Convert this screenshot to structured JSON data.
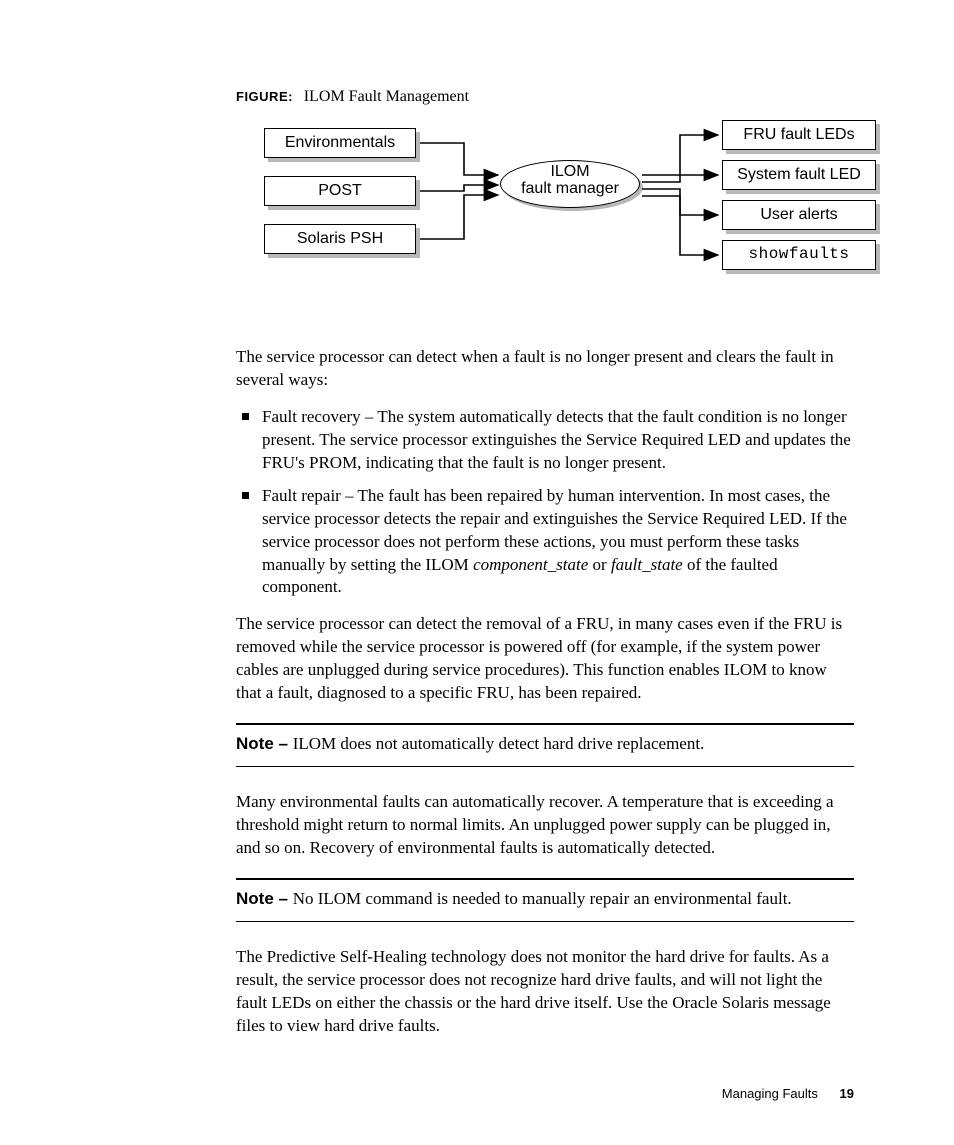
{
  "figure": {
    "label": "FIGURE:",
    "title": "ILOM Fault Management",
    "left_boxes": [
      "Environmentals",
      "POST",
      "Solaris PSH"
    ],
    "center_line1": "ILOM",
    "center_line2": "fault manager",
    "right_boxes": [
      "FRU fault LEDs",
      "System fault LED",
      "User alerts",
      "showfaults"
    ]
  },
  "para1": "The service processor can detect when a fault is no longer present and clears the fault in several ways:",
  "bullets": [
    {
      "lead": "Fault recovery – ",
      "rest": "The system automatically detects that the fault condition is no longer present. The service processor extinguishes the Service Required LED and updates the FRU's PROM, indicating that the fault is no longer present."
    },
    {
      "lead": "Fault repair – ",
      "rest_before": "The fault has been repaired by human intervention. In most cases, the service processor detects the repair and extinguishes the Service Required LED. If the service processor does not perform these actions, you must perform these tasks manually by setting the ILOM ",
      "ital1": "component_state",
      "mid": " or ",
      "ital2": "fault_state",
      "rest_after": " of the faulted component."
    }
  ],
  "para2": "The service processor can detect the removal of a FRU, in many cases even if the FRU is removed while the service processor is powered off (for example, if the system power cables are unplugged during service procedures). This function enables ILOM to know that a fault, diagnosed to a specific FRU, has been repaired.",
  "note1": {
    "label": "Note – ",
    "text": "ILOM does not automatically detect hard drive replacement."
  },
  "para3": "Many environmental faults can automatically recover. A temperature that is exceeding a threshold might return to normal limits. An unplugged power supply can be plugged in, and so on. Recovery of environmental faults is automatically detected.",
  "note2": {
    "label": "Note – ",
    "text": "No ILOM command is needed to manually repair an environmental fault."
  },
  "para4": "The Predictive Self-Healing technology does not monitor the hard drive for faults. As a result, the service processor does not recognize hard drive faults, and will not light the fault LEDs on either the chassis or the hard drive itself. Use the Oracle Solaris message files to view hard drive faults.",
  "footer": {
    "section": "Managing Faults",
    "page": "19"
  }
}
